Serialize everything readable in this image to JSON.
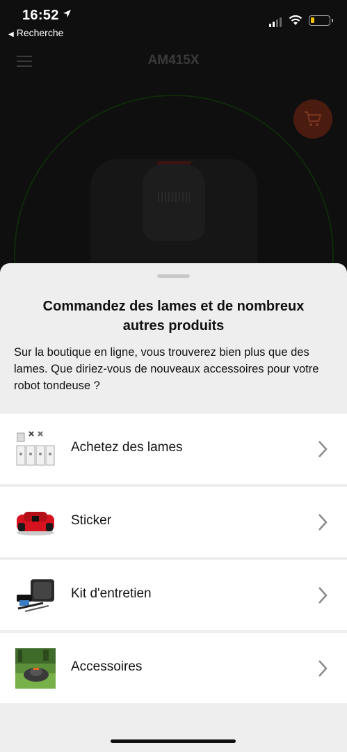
{
  "status_bar": {
    "time": "16:52",
    "back_app_label": "Recherche",
    "battery_color": "#f2c200"
  },
  "app_header": {
    "title": "AM415X",
    "menu_icon": "hamburger-menu-icon",
    "cart_icon": "shopping-cart-icon",
    "cart_color": "#4a1c10"
  },
  "sheet": {
    "title": "Commandez des lames et de nombreux autres produits",
    "description": "Sur la boutique en ligne, vous trouverez bien plus que des lames. Que diriez-vous de nouveaux accessoires pour votre robot tondeuse  ?",
    "options": [
      {
        "label": "Achetez des lames",
        "icon": "blades-pack-thumbnail"
      },
      {
        "label": "Sticker",
        "icon": "red-mower-sticker-thumbnail"
      },
      {
        "label": "Kit d'entretien",
        "icon": "maintenance-kit-thumbnail"
      },
      {
        "label": "Accessoires",
        "icon": "mower-on-lawn-thumbnail"
      }
    ],
    "chevron_icon": "chevron-right-icon"
  }
}
